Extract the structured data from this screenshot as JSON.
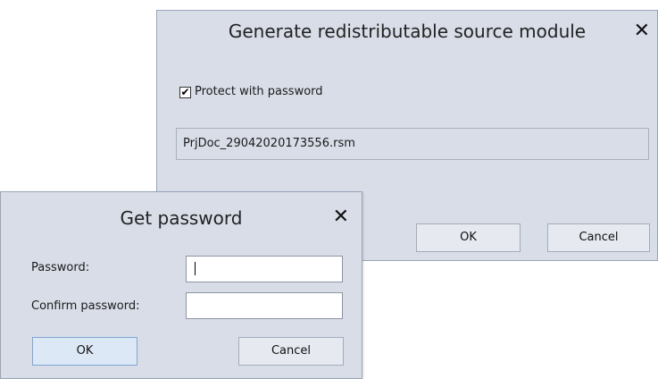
{
  "generate_dialog": {
    "title": "Generate redistributable source module",
    "close_glyph": "✕",
    "protect_checkbox": {
      "checked": true,
      "check_glyph": "✔",
      "label": "Protect with password"
    },
    "filename": "PrjDoc_29042020173556.rsm",
    "ok_label": "OK",
    "cancel_label": "Cancel"
  },
  "password_dialog": {
    "title": "Get password",
    "close_glyph": "✕",
    "password_label": "Password:",
    "password_value": "",
    "confirm_label": "Confirm password:",
    "confirm_value": "",
    "ok_label": "OK",
    "cancel_label": "Cancel"
  }
}
